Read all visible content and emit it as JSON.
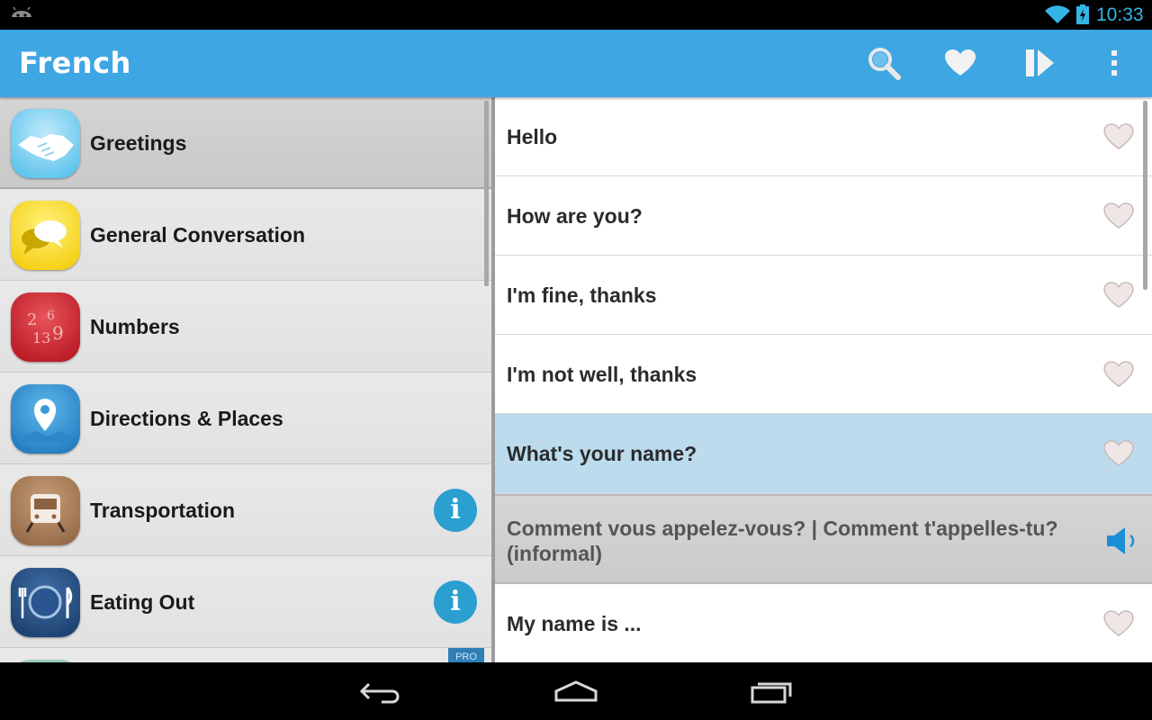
{
  "status_bar": {
    "time": "10:33",
    "icons": [
      "android-icon",
      "wifi-icon",
      "battery-icon"
    ],
    "accent_color": "#33b5e5"
  },
  "action_bar": {
    "title": "French",
    "background_color": "#3ea6e2",
    "actions": [
      "search-icon",
      "favorites-heart-icon",
      "play-icon",
      "overflow-menu-icon"
    ]
  },
  "categories": {
    "items": [
      {
        "label": "Greetings",
        "icon": "handshake-icon",
        "selected": true
      },
      {
        "label": "General Conversation",
        "icon": "speech-bubbles-icon"
      },
      {
        "label": "Numbers",
        "icon": "numbers-icon"
      },
      {
        "label": "Directions & Places",
        "icon": "map-pin-icon"
      },
      {
        "label": "Transportation",
        "icon": "train-icon",
        "info": "i"
      },
      {
        "label": "Eating Out",
        "icon": "plate-cutlery-icon",
        "info": "i"
      }
    ],
    "pro_badge": "PRO"
  },
  "phrases": {
    "items": [
      {
        "text": "Hello"
      },
      {
        "text": "How are you?"
      },
      {
        "text": "I'm fine, thanks"
      },
      {
        "text": "I'm not well, thanks"
      },
      {
        "text": "What's your name?",
        "selected": true
      },
      {
        "text": "My name is ..."
      }
    ],
    "translation": "Comment vous appelez-vous? | Comment t'appelles-tu? (informal)",
    "selected_color": "#bcdcee"
  },
  "nav_bar": {
    "buttons": [
      "back-icon",
      "home-icon",
      "recent-apps-icon"
    ]
  }
}
